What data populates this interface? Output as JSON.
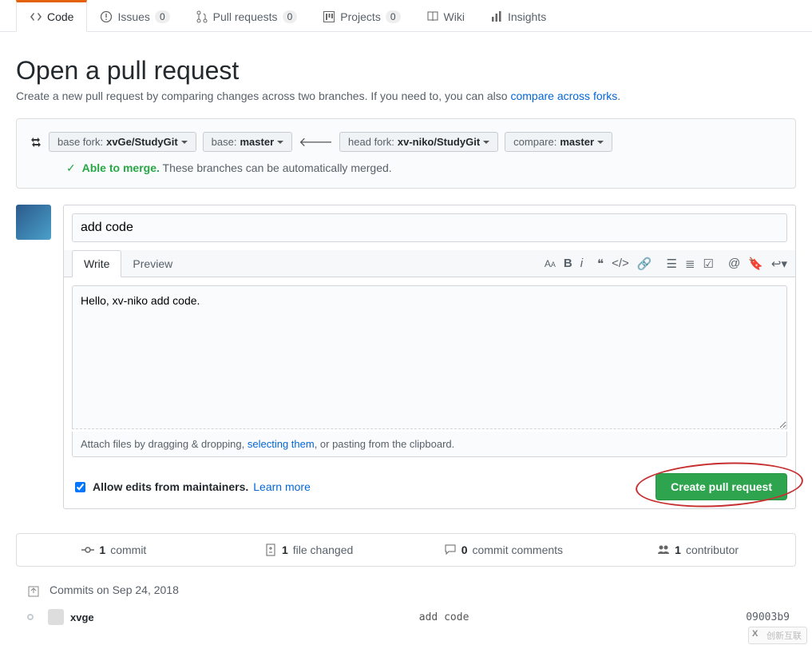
{
  "nav": {
    "code": "Code",
    "issues": "Issues",
    "issues_count": "0",
    "pull_requests": "Pull requests",
    "pr_count": "0",
    "projects": "Projects",
    "projects_count": "0",
    "wiki": "Wiki",
    "insights": "Insights"
  },
  "page": {
    "title": "Open a pull request",
    "subtitle_prefix": "Create a new pull request by comparing changes across two branches. If you need to, you can also ",
    "subtitle_link": "compare across forks",
    "subtitle_suffix": "."
  },
  "compare": {
    "base_fork_label": "base fork:",
    "base_fork_value": "xvGe/StudyGit",
    "base_label": "base:",
    "base_value": "master",
    "head_fork_label": "head fork:",
    "head_fork_value": "xv-niko/StudyGit",
    "compare_label": "compare:",
    "compare_value": "master",
    "merge_status_strong": "Able to merge.",
    "merge_status_text": "These branches can be automatically merged."
  },
  "form": {
    "title_value": "add code",
    "write_tab": "Write",
    "preview_tab": "Preview",
    "body_value": "Hello, xv-niko add code.",
    "attach_prefix": "Attach files by dragging & dropping, ",
    "attach_link": "selecting them",
    "attach_suffix": ", or pasting from the clipboard.",
    "allow_edits": "Allow edits from maintainers.",
    "learn_more": "Learn more",
    "create_button": "Create pull request"
  },
  "stats": {
    "commits_n": "1",
    "commits_t": "commit",
    "files_n": "1",
    "files_t": "file changed",
    "comments_n": "0",
    "comments_t": "commit comments",
    "contrib_n": "1",
    "contrib_t": "contributor"
  },
  "timeline": {
    "heading": "Commits on Sep 24, 2018",
    "author": "xvge",
    "message": "add code",
    "sha": "09003b9"
  },
  "watermark": "创新互联"
}
